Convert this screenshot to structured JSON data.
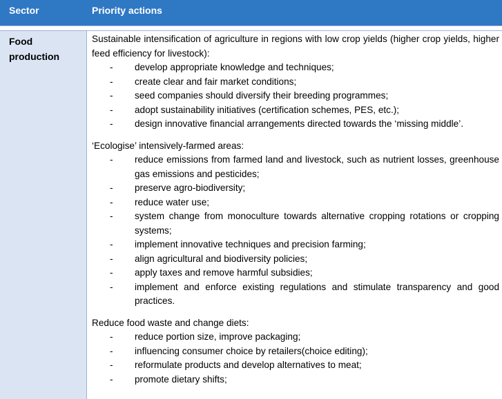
{
  "header": {
    "sector": "Sector",
    "actions": "Priority actions"
  },
  "row": {
    "sector": "Food production",
    "groups": [
      {
        "intro": "Sustainable intensification of agriculture in regions with low crop yields (higher crop yields, higher feed efficiency for livestock):",
        "items": [
          "develop appropriate knowledge and techniques;",
          "create clear and fair market conditions;",
          "seed companies should diversify their breeding programmes;",
          "adopt sustainability initiatives (certification schemes, PES, etc.);",
          "design innovative financial arrangements directed towards the ‘missing middle’."
        ]
      },
      {
        "intro": "‘Ecologise’ intensively-farmed areas:",
        "items": [
          "reduce emissions from farmed land and livestock, such as nutrient losses, greenhouse gas emissions and pesticides;",
          "preserve agro-biodiversity;",
          "reduce water use;",
          "system change from monoculture towards alternative cropping rotations or cropping systems;",
          "implement innovative techniques and precision farming;",
          "align agricultural and biodiversity policies;",
          "apply taxes and remove harmful subsidies;",
          "implement and enforce existing regulations and stimulate transparency and good practices."
        ]
      },
      {
        "intro": "Reduce food waste and change diets:",
        "items": [
          "reduce portion size, improve packaging;",
          "influencing consumer choice by retailers(choice editing);",
          "reformulate products and develop alternatives to meat;",
          "promote dietary shifts;"
        ]
      }
    ]
  },
  "colors": {
    "header_bg": "#2f78c4",
    "sector_bg": "#dbe4f2",
    "border": "#9bb3d6"
  }
}
